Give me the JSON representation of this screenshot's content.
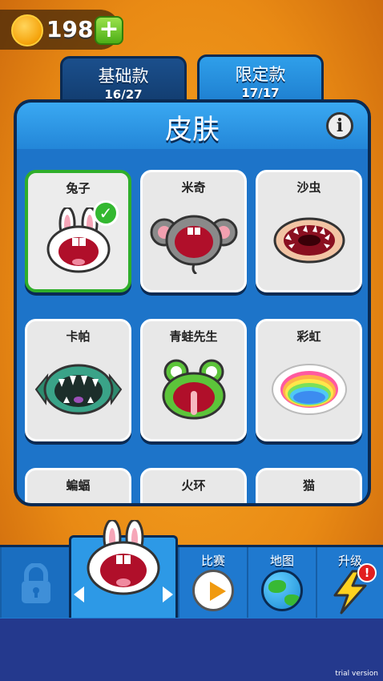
{
  "currency": {
    "coins": "198",
    "add_label": "+"
  },
  "tabs": [
    {
      "title": "基础款",
      "count": "16/27"
    },
    {
      "title": "限定款",
      "count": "17/17"
    }
  ],
  "panel": {
    "title": "皮肤",
    "info_label": "i"
  },
  "skins": [
    {
      "label": "兔子",
      "selected": true
    },
    {
      "label": "米奇",
      "selected": false
    },
    {
      "label": "沙虫",
      "selected": false
    },
    {
      "label": "卡帕",
      "selected": false
    },
    {
      "label": "青蛙先生",
      "selected": false
    },
    {
      "label": "彩虹",
      "selected": false
    },
    {
      "label": "蝙蝠",
      "selected": false
    },
    {
      "label": "火环",
      "selected": false
    },
    {
      "label": "猫",
      "selected": false
    }
  ],
  "bottom_nav": {
    "race_label": "比赛",
    "map_label": "地图",
    "upgrade_label": "升级",
    "alert_label": "!"
  },
  "colors": {
    "panel": "#1d74c9",
    "selected_border": "#2fae2a",
    "accent": "#f09a10"
  },
  "watermark": "trial version"
}
